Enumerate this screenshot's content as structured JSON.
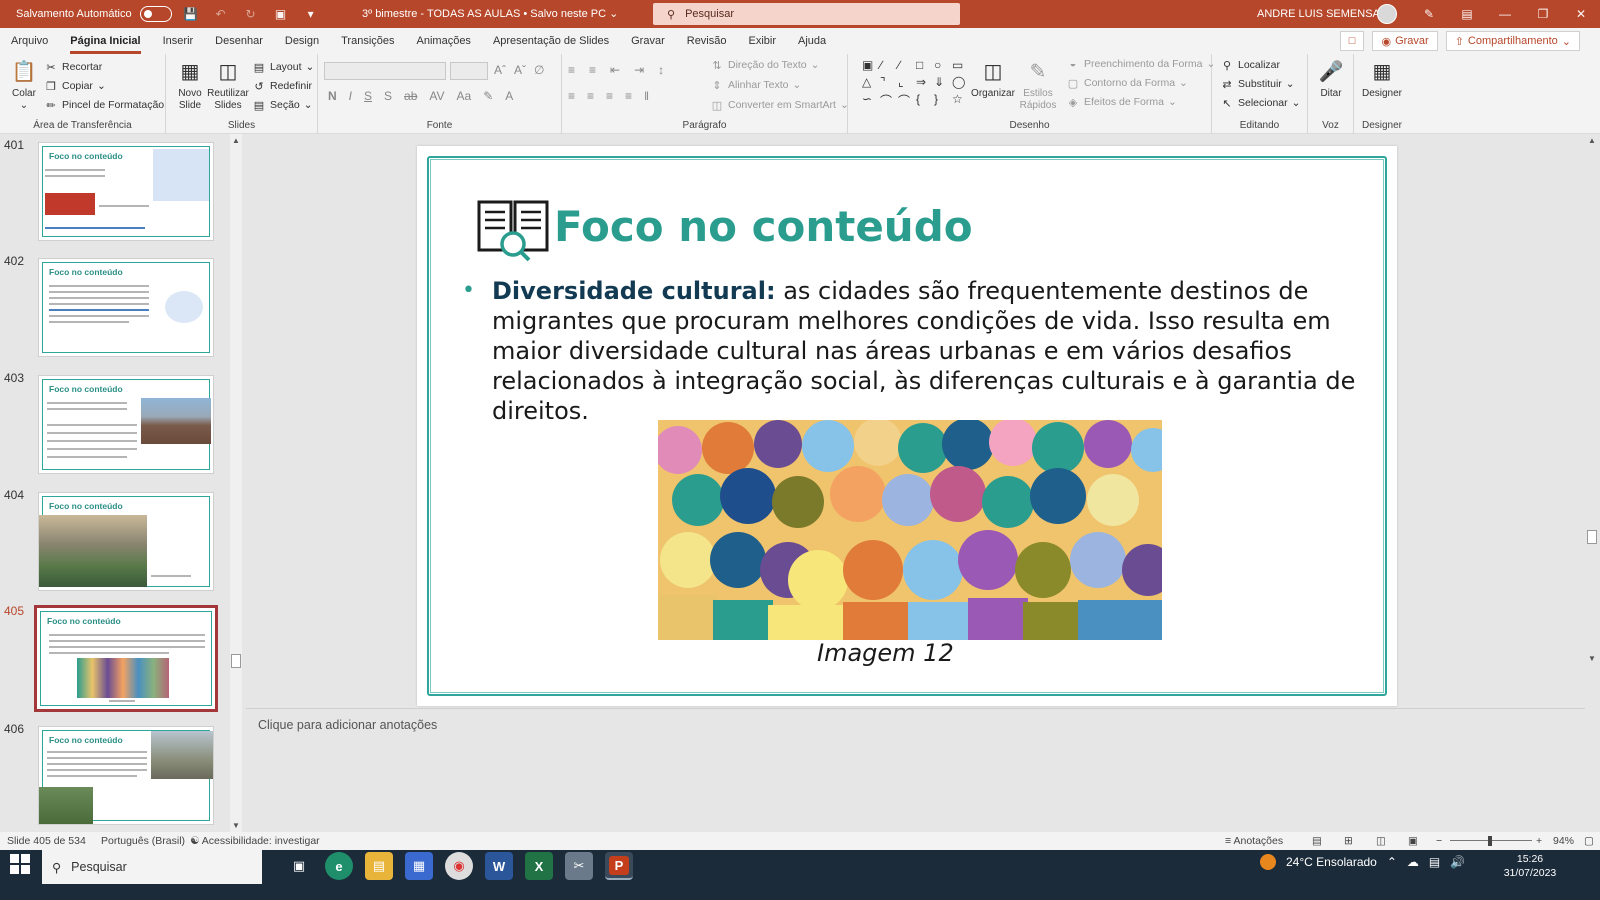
{
  "titlebar": {
    "autosave_label": "Salvamento Automático",
    "doc_title": "3º bimestre - TODAS AS AULAS • Salvo neste PC",
    "search_placeholder": "Pesquisar",
    "user_name": "ANDRE LUIS SEMENSATO"
  },
  "menu": {
    "tabs": [
      "Arquivo",
      "Página Inicial",
      "Inserir",
      "Desenhar",
      "Design",
      "Transições",
      "Animações",
      "Apresentação de Slides",
      "Gravar",
      "Revisão",
      "Exibir",
      "Ajuda"
    ],
    "record_label": "Gravar",
    "share_label": "Compartilhamento"
  },
  "ribbon": {
    "clipboard": {
      "label": "Área de Transferência",
      "paste": "Colar",
      "cut": "Recortar",
      "copy": "Copiar",
      "format_painter": "Pincel de Formatação"
    },
    "slides": {
      "label": "Slides",
      "new_slide": "Novo Slide",
      "reuse": "Reutilizar Slides",
      "layout": "Layout",
      "reset": "Redefinir",
      "section": "Seção"
    },
    "font": {
      "label": "Fonte"
    },
    "paragraph": {
      "label": "Parágrafo",
      "text_direction": "Direção do Texto",
      "align_text": "Alinhar Texto",
      "smartart": "Converter em SmartArt"
    },
    "drawing": {
      "label": "Desenho",
      "arrange": "Organizar",
      "quick_styles": "Estilos Rápidos",
      "shape_fill": "Preenchimento da Forma",
      "shape_outline": "Contorno da Forma",
      "shape_effects": "Efeitos de Forma"
    },
    "editing": {
      "label": "Editando",
      "find": "Localizar",
      "replace": "Substituir",
      "select": "Selecionar"
    },
    "voice": {
      "label": "Voz",
      "dictate": "Ditar"
    },
    "designer": {
      "label": "Designer",
      "designer": "Designer"
    }
  },
  "thumbnails": [
    {
      "num": "401",
      "title": "Foco no conteúdo"
    },
    {
      "num": "402",
      "title": "Foco no conteúdo"
    },
    {
      "num": "403",
      "title": "Foco no conteúdo"
    },
    {
      "num": "404",
      "title": "Foco no conteúdo"
    },
    {
      "num": "405",
      "title": "Foco no conteúdo"
    },
    {
      "num": "406",
      "title": "Foco no conteúdo"
    }
  ],
  "slide": {
    "title": "Foco no conteúdo",
    "bullet_bold": "Diversidade cultural:",
    "bullet_text": " as cidades são frequentemente destinos de migrantes que procuram melhores condições de vida. Isso resulta em maior diversidade cultural nas áreas urbanas e em vários desafios relacionados à integração social, às diferenças culturais e à garantia de direitos.",
    "caption": "Imagem  12"
  },
  "notes_placeholder": "Clique para adicionar anotações",
  "status": {
    "slide_counter": "Slide 405 de 534",
    "language": "Português (Brasil)",
    "accessibility": "Acessibilidade: investigar",
    "notes": "Anotações",
    "zoom": "94%"
  },
  "taskbar": {
    "search": "Pesquisar",
    "weather": "24°C  Ensolarado",
    "time": "15:26",
    "date": "31/07/2023"
  },
  "colors": {
    "accent": "#b7472a",
    "teal": "#2a9d8f"
  }
}
